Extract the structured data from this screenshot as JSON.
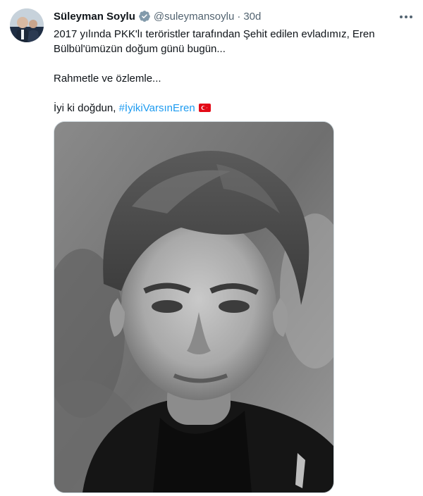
{
  "tweet": {
    "author_name": "Süleyman Soylu",
    "handle": "@suleymansoylu",
    "separator": "·",
    "time": "30d",
    "line1": "2017 yılında PKK'lı teröristler tarafından Şehit edilen evladımız, Eren Bülbül'ümüzün doğum günü bugün...",
    "line2": "Rahmetle ve özlemle...",
    "line3_prefix": "İyi ki doğdun, ",
    "hashtag": "#İyikiVarsınEren",
    "icons": {
      "verified": "verified-badge-icon",
      "more": "more-options-icon",
      "flag": "turkey-flag-emoji"
    },
    "colors": {
      "link": "#1d9bf0",
      "secondary": "#536471",
      "verified": "#829aab",
      "flag_red": "#e30a17"
    }
  }
}
